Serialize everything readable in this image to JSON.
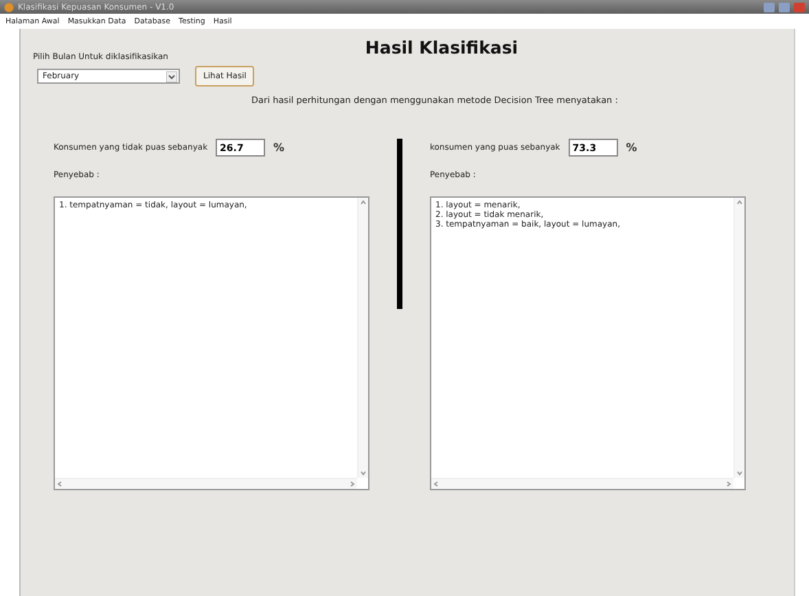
{
  "window": {
    "title": "Klasifikasi Kepuasan Konsumen - V1.0"
  },
  "menu": [
    "Halaman Awal",
    "Masukkan Data",
    "Database",
    "Testing",
    "Hasil"
  ],
  "heading": "Hasil Klasifikasi",
  "month_label": "Pilih Bulan Untuk diklasifikasikan",
  "month_select": {
    "value": "February"
  },
  "show_button": "Lihat Hasil",
  "statement": "Dari hasil perhitungan dengan menggunakan metode Decision Tree menyatakan :",
  "panels": [
    {
      "label": "Konsumen yang tidak puas sebanyak",
      "value": "26.7",
      "unit": "%",
      "cause_label": "Penyebab :",
      "causes": [
        "1. tempatnyaman = tidak, layout = lumayan,"
      ]
    },
    {
      "label": "konsumen yang puas sebanyak",
      "value": "73.3",
      "unit": "%",
      "cause_label": "Penyebab :",
      "causes": [
        "1. layout = menarik,",
        "2. layout = tidak menarik,",
        "3. tempatnyaman = baik, layout = lumayan,"
      ]
    }
  ]
}
